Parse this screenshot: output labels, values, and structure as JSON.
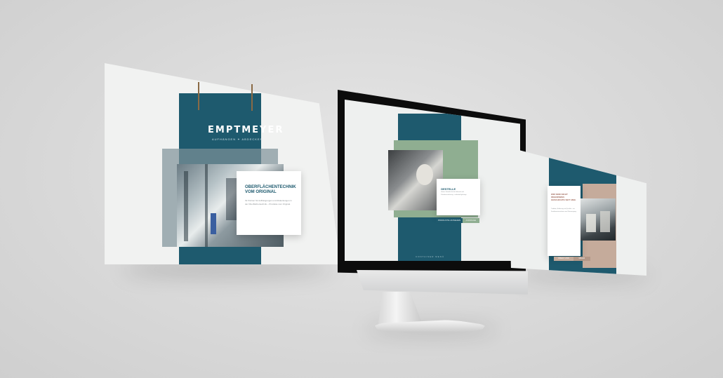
{
  "left_screen": {
    "logo": "EMPTMEYER",
    "logo_subtitle": "AUFHÄNGEN ✦ ABDECKEN",
    "card_title_line1": "OBERFLÄCHENTECHNIK",
    "card_title_line2": "VOM ORIGINAL",
    "card_body": "Ihr Partner für Aufhängungen und Abdeckungen in der Oberflächentechnik – Produkte vom Original."
  },
  "center_screen": {
    "card_title": "GESTELLE",
    "card_body": "Unsere Gestelle für die Galvanik und Pulverbeschichtung – individuell gefertigt.",
    "button_left": "PRODUKTE ANSEHEN",
    "button_right": "ANFRAGE",
    "footer_label": "CONTAINER MENÜ"
  },
  "right_screen": {
    "card_title": "WIR SIND NICHT IRGENDWER. GESCHICHTE SEIT 1899.",
    "card_body": "Tradition, Erfahrung und Qualität – ein Familienunternehmen aus Überzeugung.",
    "button_left": "ÜBER UNS",
    "button_right": "MEHR"
  },
  "colors": {
    "teal": "#1e5a6e",
    "sage": "#8fae91",
    "taupe": "#c5ab9b",
    "slate": "#7d9299",
    "background": "#d9d9d9"
  }
}
